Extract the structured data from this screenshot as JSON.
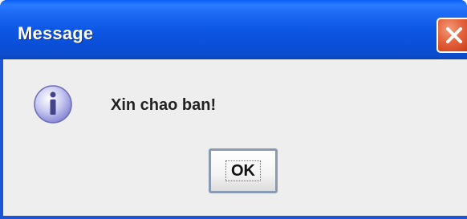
{
  "dialog": {
    "title": "Message",
    "message": "Xin chao ban!",
    "icon": "info-icon",
    "ok_label": "OK"
  },
  "colors": {
    "titlebar": "#0d57e4",
    "close_button": "#e4623c",
    "content_background": "#eeeeee"
  }
}
